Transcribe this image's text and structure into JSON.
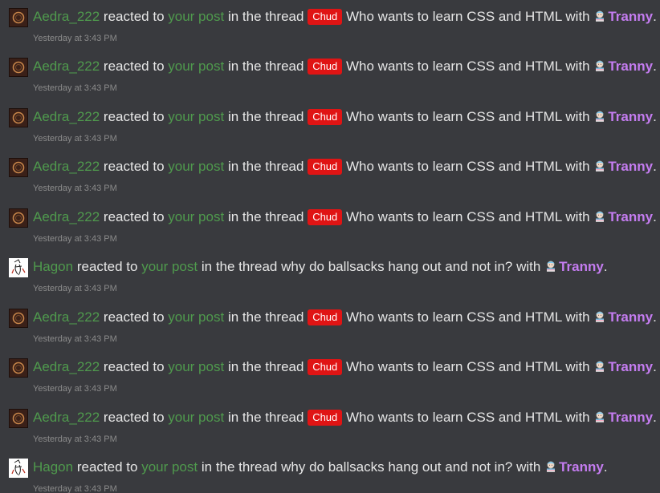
{
  "alerts": [
    {
      "user": "Aedra_222",
      "avatar_icon": "dark-ring-avatar",
      "action": "reacted to",
      "post_link": "your post",
      "in_thread": "in the thread",
      "prefix": "Chud",
      "thread_title": "Who wants to learn CSS and HTML",
      "with": "with",
      "reaction_icon": "tranny-flag-emoji-icon",
      "reaction": "Tranny",
      "period": ".",
      "time": "Yesterday at 3:43 PM"
    },
    {
      "user": "Aedra_222",
      "avatar_icon": "dark-ring-avatar",
      "action": "reacted to",
      "post_link": "your post",
      "in_thread": "in the thread",
      "prefix": "Chud",
      "thread_title": "Who wants to learn CSS and HTML",
      "with": "with",
      "reaction_icon": "tranny-flag-emoji-icon",
      "reaction": "Tranny",
      "period": ".",
      "time": "Yesterday at 3:43 PM"
    },
    {
      "user": "Aedra_222",
      "avatar_icon": "dark-ring-avatar",
      "action": "reacted to",
      "post_link": "your post",
      "in_thread": "in the thread",
      "prefix": "Chud",
      "thread_title": "Who wants to learn CSS and HTML",
      "with": "with",
      "reaction_icon": "tranny-flag-emoji-icon",
      "reaction": "Tranny",
      "period": ".",
      "time": "Yesterday at 3:43 PM"
    },
    {
      "user": "Aedra_222",
      "avatar_icon": "dark-ring-avatar",
      "action": "reacted to",
      "post_link": "your post",
      "in_thread": "in the thread",
      "prefix": "Chud",
      "thread_title": "Who wants to learn CSS and HTML",
      "with": "with",
      "reaction_icon": "tranny-flag-emoji-icon",
      "reaction": "Tranny",
      "period": ".",
      "time": "Yesterday at 3:43 PM"
    },
    {
      "user": "Aedra_222",
      "avatar_icon": "dark-ring-avatar",
      "action": "reacted to",
      "post_link": "your post",
      "in_thread": "in the thread",
      "prefix": "Chud",
      "thread_title": "Who wants to learn CSS and HTML",
      "with": "with",
      "reaction_icon": "tranny-flag-emoji-icon",
      "reaction": "Tranny",
      "period": ".",
      "time": "Yesterday at 3:43 PM"
    },
    {
      "user": "Hagon",
      "avatar_icon": "sketch-avatar",
      "action": "reacted to",
      "post_link": "your post",
      "in_thread": "in the thread",
      "prefix": "",
      "thread_title": "why do ballsacks hang out and not in?",
      "with": "with",
      "reaction_icon": "tranny-flag-emoji-icon",
      "reaction": "Tranny",
      "period": ".",
      "time": "Yesterday at 3:43 PM"
    },
    {
      "user": "Aedra_222",
      "avatar_icon": "dark-ring-avatar",
      "action": "reacted to",
      "post_link": "your post",
      "in_thread": "in the thread",
      "prefix": "Chud",
      "thread_title": "Who wants to learn CSS and HTML",
      "with": "with",
      "reaction_icon": "tranny-flag-emoji-icon",
      "reaction": "Tranny",
      "period": ".",
      "time": "Yesterday at 3:43 PM"
    },
    {
      "user": "Aedra_222",
      "avatar_icon": "dark-ring-avatar",
      "action": "reacted to",
      "post_link": "your post",
      "in_thread": "in the thread",
      "prefix": "Chud",
      "thread_title": "Who wants to learn CSS and HTML",
      "with": "with",
      "reaction_icon": "tranny-flag-emoji-icon",
      "reaction": "Tranny",
      "period": ".",
      "time": "Yesterday at 3:43 PM"
    },
    {
      "user": "Aedra_222",
      "avatar_icon": "dark-ring-avatar",
      "action": "reacted to",
      "post_link": "your post",
      "in_thread": "in the thread",
      "prefix": "Chud",
      "thread_title": "Who wants to learn CSS and HTML",
      "with": "with",
      "reaction_icon": "tranny-flag-emoji-icon",
      "reaction": "Tranny",
      "period": ".",
      "time": "Yesterday at 3:43 PM"
    },
    {
      "user": "Hagon",
      "avatar_icon": "sketch-avatar",
      "action": "reacted to",
      "post_link": "your post",
      "in_thread": "in the thread",
      "prefix": "",
      "thread_title": "why do ballsacks hang out and not in?",
      "with": "with",
      "reaction_icon": "tranny-flag-emoji-icon",
      "reaction": "Tranny",
      "period": ".",
      "time": "Yesterday at 3:43 PM"
    }
  ],
  "colors": {
    "background": "#393a3e",
    "username": "#4f9a4d",
    "link": "#4f9a4d",
    "text": "#e6e6e6",
    "prefix_bg": "#e01414",
    "reaction": "#c47cf0",
    "timestamp": "#8b8b8b"
  }
}
